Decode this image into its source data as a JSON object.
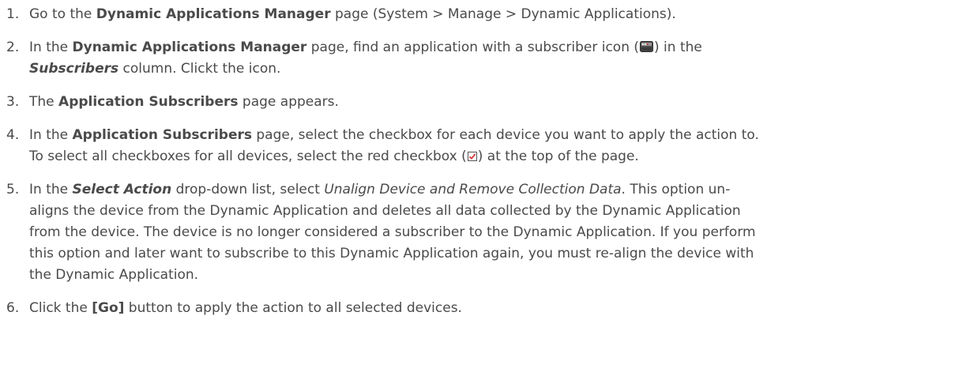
{
  "steps": [
    {
      "number": "1.",
      "t1": "Go to the ",
      "t2": "Dynamic Applications Manager",
      "t3": " page (System > Manage > Dynamic Applications)."
    },
    {
      "number": "2.",
      "t1": "In the ",
      "t2": "Dynamic Applications Manager",
      "t3": " page, find an application with a subscriber icon (",
      "t4": ") in the",
      "t5": "Subscribers",
      "t6": " column. Clickt the icon."
    },
    {
      "number": "3.",
      "t1": "The ",
      "t2": "Application Subscribers",
      "t3": " page appears."
    },
    {
      "number": "4.",
      "t1": "In the ",
      "t2": "Application Subscribers",
      "t3": " page, select the checkbox for each device you want to apply the action to.",
      "t4": "To select all checkboxes for all devices, select the red checkbox (",
      "t5": ") at the top of the page."
    },
    {
      "number": "5.",
      "t1": "In the ",
      "t2": "Select Action",
      "t3": " drop-down list, select ",
      "t4": "Unalign Device and Remove Collection Data",
      "t5": ". This option un-",
      "t6": "aligns the device from the Dynamic Application and deletes all data collected by the Dynamic Application",
      "t7": "from the device. The device is no longer considered a subscriber to the Dynamic Application. If you perform",
      "t8": "this option and later want to subscribe to this Dynamic Application again, you must re-align the device with",
      "t9": "the Dynamic Application."
    },
    {
      "number": "6.",
      "t1": "Click the ",
      "t2": "[Go]",
      "t3": " button to apply the action to all selected devices."
    }
  ],
  "icons": {
    "subscriber": "subscriber-icon",
    "red_checkbox": "red-checkbox-icon"
  },
  "colors": {
    "text": "#4a4a4a",
    "checkbox_red": "#d83a3a"
  }
}
